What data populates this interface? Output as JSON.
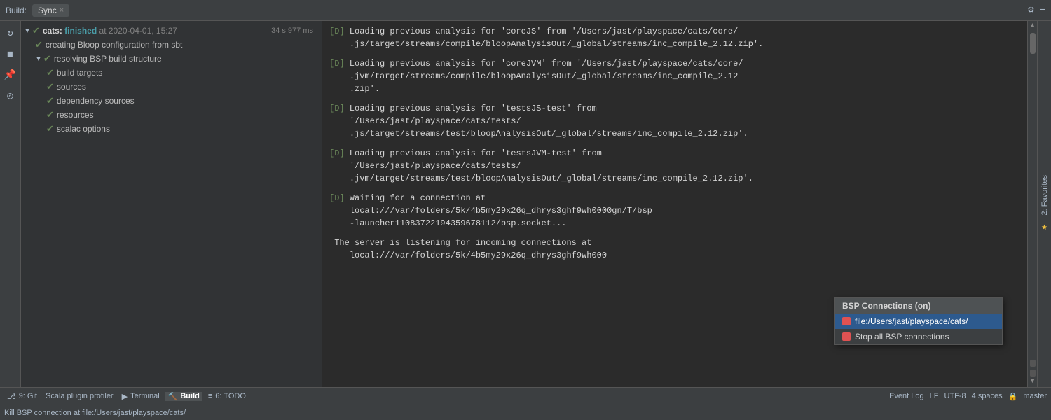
{
  "header": {
    "build_label": "Build:",
    "tab_label": "Sync",
    "close_label": "×",
    "settings_icon": "⚙",
    "minimize_icon": "−"
  },
  "left_sidebar_icons": [
    {
      "name": "refresh-icon",
      "glyph": "↻"
    },
    {
      "name": "stop-icon",
      "glyph": "◼"
    },
    {
      "name": "pin-icon",
      "glyph": "📌"
    },
    {
      "name": "eye-icon",
      "glyph": "◎"
    }
  ],
  "tree": {
    "rows": [
      {
        "indent": 0,
        "expand": "▼",
        "check": "✔",
        "label_prefix": "cats:",
        "label_bold": " finished",
        "label_rest": " at 2020-04-01, 15:27",
        "timing": "34 s 977 ms",
        "is_bold": true
      },
      {
        "indent": 1,
        "expand": "",
        "check": "✔",
        "label": "creating Bloop configuration from sbt",
        "timing": ""
      },
      {
        "indent": 1,
        "expand": "▼",
        "check": "✔",
        "label": "resolving BSP build structure",
        "timing": ""
      },
      {
        "indent": 2,
        "expand": "",
        "check": "✔",
        "label": "build targets",
        "timing": ""
      },
      {
        "indent": 2,
        "expand": "",
        "check": "✔",
        "label": "sources",
        "timing": ""
      },
      {
        "indent": 2,
        "expand": "",
        "check": "✔",
        "label": "dependency sources",
        "timing": ""
      },
      {
        "indent": 2,
        "expand": "",
        "check": "✔",
        "label": "resources",
        "timing": ""
      },
      {
        "indent": 2,
        "expand": "",
        "check": "✔",
        "label": "scalac options",
        "timing": ""
      }
    ]
  },
  "log": {
    "entries": [
      {
        "tag": "[D]",
        "text": " Loading previous analysis for 'coreJS' from '/Users/jast/playspace/cats/core/\n    .js/target/streams/compile/bloopAnalysisOut/_global/streams/inc_compile_2.12.zip'."
      },
      {
        "tag": "[D]",
        "text": " Loading previous analysis for 'coreJVM' from '/Users/jast/playspace/cats/core/\n    .jvm/target/streams/compile/bloopAnalysisOut/_global/streams/inc_compile_2.12\n    .zip'."
      },
      {
        "tag": "[D]",
        "text": " Loading previous analysis for 'testsJS-test' from\n    '/Users/jast/playspace/cats/tests/\n    .js/target/streams/test/bloopAnalysisOut/_global/streams/inc_compile_2.12.zip'."
      },
      {
        "tag": "[D]",
        "text": " Loading previous analysis for 'testsJVM-test' from\n    '/Users/jast/playspace/cats/tests/\n    .jvm/target/streams/test/bloopAnalysisOut/_global/streams/inc_compile_2.12.zip'."
      },
      {
        "tag": "[D]",
        "text": " Waiting for a connection at\n    local:///var/folders/5k/4b5my29x26q_dhrys3ghf9wh0000gn/T/bsp\n    -launcher1108372219435967811​2/bsp.socket..."
      },
      {
        "tag": "",
        "text": " The server is listening for incoming connections at\n    local:///var/folders/5k/4b5my29x26q_dhrys3ghf9wh000"
      }
    ]
  },
  "popup": {
    "title": "BSP Connections (on)",
    "items": [
      {
        "label": "file:/Users/jast/playspace/cats/",
        "selected": true,
        "has_square": true
      },
      {
        "label": "Stop all BSP connections",
        "selected": false,
        "has_square": true
      }
    ]
  },
  "status_bar": {
    "items": [
      {
        "icon": "⎇",
        "label": "9: Git"
      },
      {
        "icon": "",
        "label": "Scala plugin profiler"
      },
      {
        "icon": "▶",
        "label": "Terminal"
      },
      {
        "icon": "🔨",
        "label": "Build",
        "active": true
      },
      {
        "icon": "≡",
        "label": "6: TODO"
      }
    ],
    "right_items": [
      "Event Log"
    ],
    "bottom_indicators": [
      "LF",
      "UTF-8",
      "4 spaces",
      "🔒",
      "master"
    ]
  },
  "kill_bar": {
    "text": "Kill BSP connection at file:/Users/jast/playspace/cats/"
  },
  "favorites": {
    "label": "2: Favorites",
    "star_icon": "★"
  }
}
